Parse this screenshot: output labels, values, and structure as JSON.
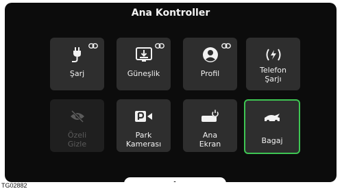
{
  "screen": {
    "title": "Ana Kontroller"
  },
  "tiles": [
    {
      "label_lines": [
        "Şarj"
      ],
      "icon": "ev-plug-icon",
      "linked": true
    },
    {
      "label_lines": [
        "Güneşlik"
      ],
      "icon": "sunshade-icon",
      "linked": true
    },
    {
      "label_lines": [
        "Profil"
      ],
      "icon": "profile-icon",
      "linked": true
    },
    {
      "label_lines": [
        "Telefon",
        "Şarjı"
      ],
      "icon": "wireless-charge-icon",
      "linked": false
    },
    {
      "label_lines": [
        "Özeli",
        "Gizle"
      ],
      "icon": "privacy-hide-icon",
      "linked": false,
      "disabled": true
    },
    {
      "label_lines": [
        "Park",
        "Kamerası"
      ],
      "icon": "park-camera-icon",
      "linked": false
    },
    {
      "label_lines": [
        "Ana",
        "Ekran"
      ],
      "icon": "main-screen-power-icon",
      "linked": false
    },
    {
      "label_lines": [
        "Bagaj"
      ],
      "icon": "trunk-icon",
      "linked": false,
      "selected": true
    }
  ],
  "bottom_handle": {
    "icon": "chevron-up-icon"
  },
  "figure_code": "TG02882",
  "colors": {
    "background": "#0c0c0c",
    "tile": "#2e2e2e",
    "selected_border": "#3ec653",
    "text": "#f2f2f2",
    "disabled_text": "#5b5b5b"
  }
}
